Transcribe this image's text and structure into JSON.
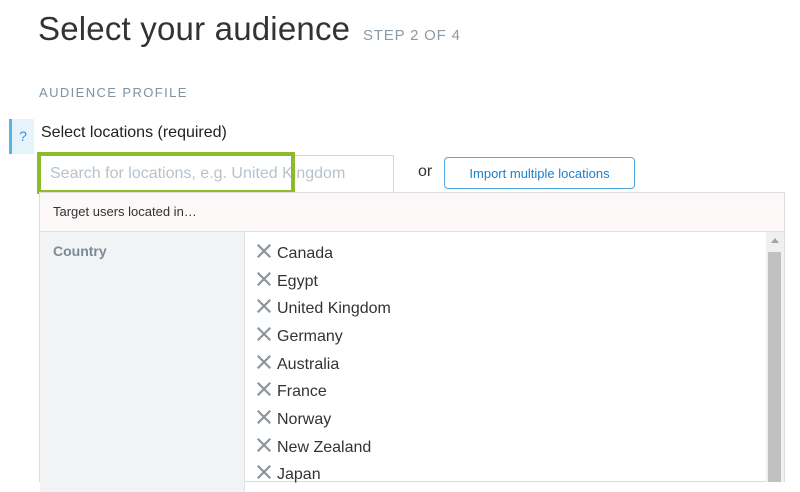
{
  "header": {
    "title": "Select your audience",
    "step": "STEP 2 OF 4"
  },
  "section": {
    "heading": "AUDIENCE PROFILE"
  },
  "locations": {
    "help_icon": "?",
    "label": "Select locations (required)",
    "search_placeholder": "Search for locations, e.g. United Kingdom",
    "search_value": "",
    "or_text": "or",
    "import_button": "Import multiple locations",
    "focus_color": "#8cbb2c"
  },
  "targets": {
    "header": "Target users located in…",
    "group_label": "Country",
    "remove_icon": "close-icon",
    "items": [
      "Canada",
      "Egypt",
      "United Kingdom",
      "Germany",
      "Australia",
      "France",
      "Norway",
      "New Zealand",
      "Japan"
    ]
  }
}
